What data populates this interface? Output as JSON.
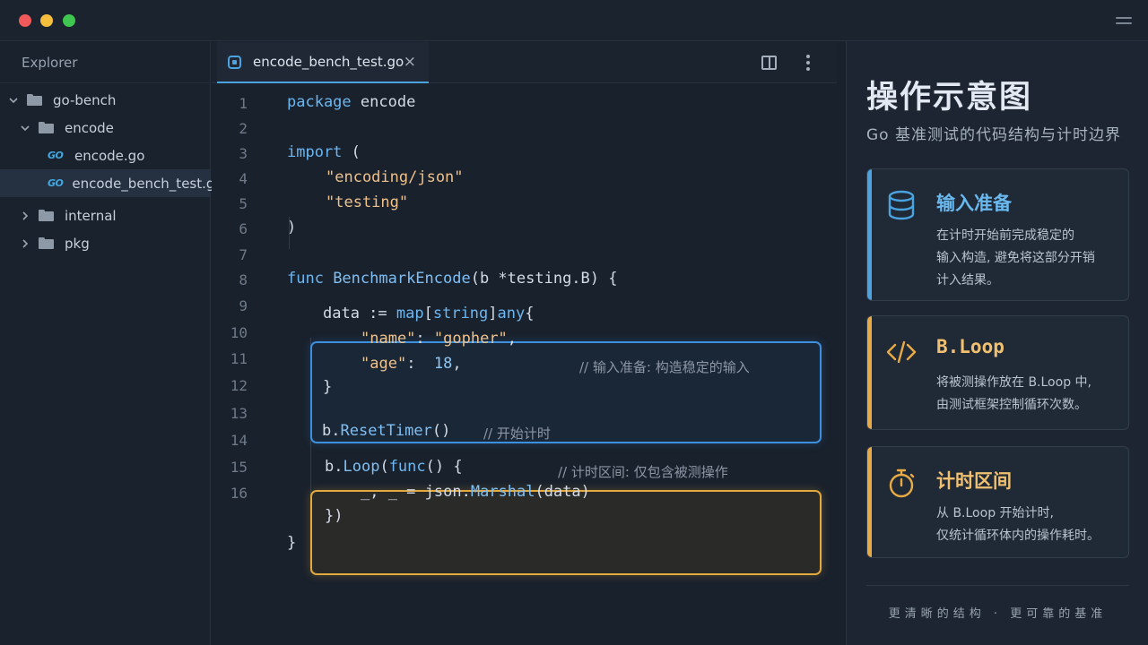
{
  "window": {
    "controls": [
      "close",
      "minimize",
      "maximize"
    ]
  },
  "sidebar": {
    "header": "Explorer",
    "tree": [
      {
        "label": "go-bench",
        "type": "folder",
        "expanded": true,
        "depth": 0
      },
      {
        "label": "encode",
        "type": "folder",
        "expanded": true,
        "depth": 1
      },
      {
        "label": "encode.go",
        "type": "go-file",
        "depth": 2,
        "badge": "GO"
      },
      {
        "label": "encode_bench_test.go",
        "type": "go-file",
        "depth": 2,
        "badge": "GO",
        "selected": true
      },
      {
        "label": "internal",
        "type": "folder",
        "expanded": false,
        "depth": 1
      },
      {
        "label": "pkg",
        "type": "folder",
        "expanded": false,
        "depth": 1
      }
    ]
  },
  "editor": {
    "tab": {
      "label": "encode_bench_test.go",
      "close": "×"
    },
    "line_numbers": [
      "1",
      "2",
      "3",
      "4",
      "5",
      "6",
      "7",
      "8",
      "9",
      "10",
      "11",
      "12",
      "13",
      "14",
      "15",
      "16"
    ],
    "code": {
      "l1_kw": "package",
      "l1_rest": " encode",
      "l3_kw": "import",
      "l3_rest": " (",
      "l4_str": "\"encoding/json\"",
      "l5_str": "\"testing\"",
      "l6": ")",
      "l8_kw": "func",
      "l8_fn": " BenchmarkEncode",
      "l8_rest": "(b *testing.B) {",
      "l9_a": "data := ",
      "l9_kw1": "map",
      "l9_b": "[",
      "l9_kw2": "string",
      "l9_c": "]",
      "l9_kw3": "any",
      "l9_d": "{",
      "l9_comment": "// 输入准备: 构造稳定的输入",
      "l10_str1": "\"name\"",
      "l10_mid": ": ",
      "l10_str2": "\"gopher\"",
      "l10_end": ",",
      "l11_str": "\"age\"",
      "l11_mid": ":  ",
      "l11_num": "18",
      "l11_end": ",",
      "l12": "}",
      "l14_a": "b.",
      "l14_fn": "ResetTimer",
      "l14_b": "()",
      "l14_comment": "// 开始计时",
      "l15_a": "b.",
      "l15_fn": "Loop",
      "l15_b": "(",
      "l15_kw": "func",
      "l15_c": "() {",
      "l15_comment": "// 计时区间: 仅包含被测操作",
      "l16_a": "_, _ = json.",
      "l16_fn": "Marshal",
      "l16_b": "(data)",
      "l17": "})",
      "l18": "}"
    }
  },
  "panel": {
    "title": "操作示意图",
    "subtitle": "Go 基准测试的代码结构与计时边界",
    "cards": [
      {
        "title": "输入准备",
        "desc_line1": "在计时开始前完成稳定的",
        "desc_line2": "输入构造, 避免将这部分开销",
        "desc_line3": "计入结果。",
        "color": "#4aa3df",
        "icon": "database-icon"
      },
      {
        "title": "B.Loop",
        "desc_line1": "将被测操作放在 B.Loop 中,",
        "desc_line2": "由测试框架控制循环次数。",
        "color": "#e8aa45",
        "icon": "code-brackets-icon"
      },
      {
        "title": "计时区间",
        "desc_line1": "从 B.Loop 开始计时,",
        "desc_line2": "仅统计循环体内的操作耗时。",
        "color": "#e8aa45",
        "icon": "stopwatch-icon"
      }
    ],
    "footer": "更清晰的结构 · 更可靠的基准"
  },
  "colors": {
    "accent_blue": "#4aa3df",
    "accent_amber": "#e8aa45",
    "background": "#19212c"
  }
}
